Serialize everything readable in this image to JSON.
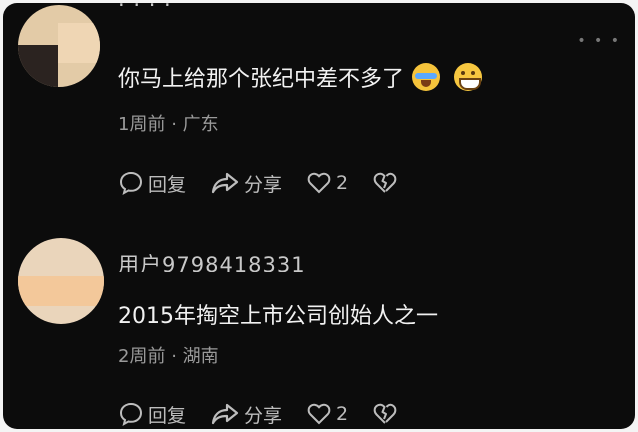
{
  "comments": [
    {
      "username": "· ·  ·  ·",
      "content": "你马上给那个张纪中差不多了",
      "time": "1周前",
      "location": "广东",
      "reply_label": "回复",
      "share_label": "分享",
      "like_count": "2",
      "emojis": [
        "crying-emoji",
        "grinning-emoji"
      ]
    },
    {
      "username": "用户9798418331",
      "content": "2015年掏空上市公司创始人之一",
      "time": "2周前",
      "location": "湖南",
      "reply_label": "回复",
      "share_label": "分享",
      "like_count": "2"
    }
  ],
  "more_icon": "more-dots-icon",
  "separator": "·"
}
